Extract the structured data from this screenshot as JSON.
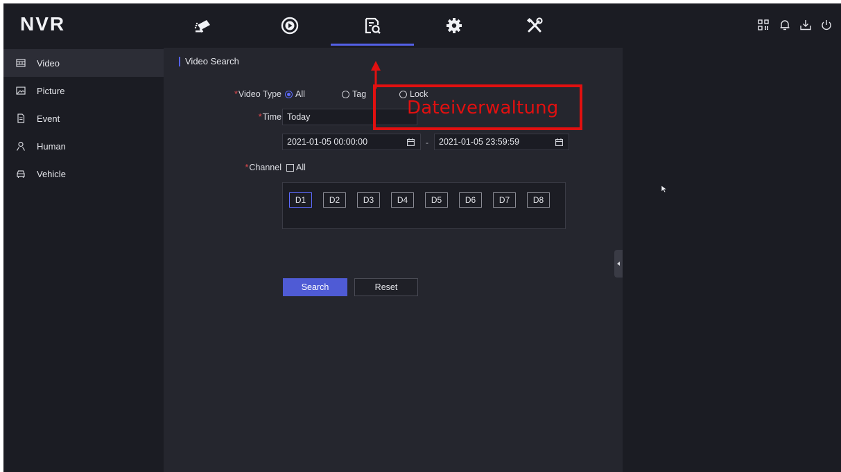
{
  "app": {
    "logo": "NVR"
  },
  "topnav": [
    {
      "id": "live",
      "icon": "camera-icon",
      "active": false
    },
    {
      "id": "playback",
      "icon": "playback-icon",
      "active": false
    },
    {
      "id": "files",
      "icon": "file-search-icon",
      "active": true
    },
    {
      "id": "config",
      "icon": "gear-icon",
      "active": false
    },
    {
      "id": "maintenance",
      "icon": "tools-icon",
      "active": false
    }
  ],
  "topright_icons": [
    "qr-icon",
    "bell-icon",
    "download-icon",
    "power-icon"
  ],
  "sidebar": {
    "items": [
      {
        "label": "Video",
        "icon": "film-icon",
        "active": true
      },
      {
        "label": "Picture",
        "icon": "picture-icon",
        "active": false
      },
      {
        "label": "Event",
        "icon": "document-icon",
        "active": false
      },
      {
        "label": "Human",
        "icon": "person-icon",
        "active": false
      },
      {
        "label": "Vehicle",
        "icon": "car-icon",
        "active": false
      }
    ]
  },
  "main": {
    "title": "Video Search",
    "video_type": {
      "required_mark": "*",
      "label": "Video Type",
      "options": [
        "All",
        "Tag",
        "Lock"
      ],
      "selected": "All"
    },
    "time": {
      "required_mark": "*",
      "label": "Time",
      "value": "Today",
      "start": "2021-01-05 00:00:00",
      "separator": "-",
      "end": "2021-01-05 23:59:59"
    },
    "channel": {
      "required_mark": "*",
      "label": "Channel",
      "all_label": "All",
      "all_checked": false,
      "channels": [
        "D1",
        "D2",
        "D3",
        "D4",
        "D5",
        "D6",
        "D7",
        "D8"
      ],
      "selected": "D1"
    },
    "buttons": {
      "search": "Search",
      "reset": "Reset"
    }
  },
  "annotation": {
    "text": "Dateiverwaltung",
    "color": "#e11010"
  },
  "colors": {
    "accent": "#5461e8",
    "background": "#25262e",
    "panel": "#1b1c23"
  }
}
